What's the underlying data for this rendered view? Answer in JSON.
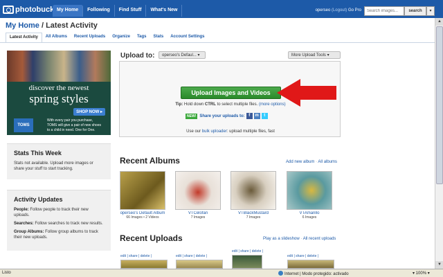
{
  "topbar": {
    "logo": "photobucket",
    "nav": [
      "My Home",
      "Following",
      "Find Stuff",
      "What's New"
    ],
    "user": "operseo",
    "logout": "(Logout)",
    "gopro": "Go Pro",
    "search_placeholder": "Search images...",
    "search_button": "search",
    "search_drop": "▾"
  },
  "page": {
    "title_main": "My Home",
    "title_sep": " / ",
    "title_sub": "Latest Activity",
    "tabs": [
      "Latest Activity",
      "All Albums",
      "Recent Uploads",
      "Organize",
      "Tags",
      "Stats",
      "Account Settings"
    ]
  },
  "ad": {
    "line1": "discover the newest",
    "line2": "spring styles",
    "shop": "SHOP NOW ▸",
    "brand": "TOMS",
    "tagline_1": "With every pair you purchase,",
    "tagline_2": "TOMS will give a pair of new shoes",
    "tagline_3": "to a child in need. One for One."
  },
  "stats": {
    "title": "Stats This Week",
    "text": "Stats not available. Upload more images or share your stuff to start tracking."
  },
  "activity": {
    "title": "Activity Updates",
    "items": [
      {
        "label": "People:",
        "text": " Follow people to track their new uploads."
      },
      {
        "label": "Searches:",
        "text": " Follow searches to track new results."
      },
      {
        "label": "Group Albums:",
        "text": " Follow group albums to track their new uploads."
      }
    ]
  },
  "upload": {
    "label": "Upload to:",
    "album_select": "operseo's Defaul... ▾",
    "more_tools": "More Upload Tools ▾",
    "button": "Upload Images and Videos",
    "tip_prefix": "Tip:",
    "tip_text": " Hold down ",
    "tip_key": "CTRL",
    "tip_text2": " to select multiple files. ",
    "tip_link": "(more options)",
    "new_badge": "NEW!",
    "share_text": "Share your uploads to:",
    "bulk_prefix": "Use our ",
    "bulk_link": "bulk uploader",
    "bulk_suffix": ": upload multiple files, fast"
  },
  "albums": {
    "title": "Recent Albums",
    "add_link": "Add new album",
    "sep": " · ",
    "all_link": "All albums",
    "items": [
      {
        "name": "operseo's Default Album",
        "count": "66 Images • 2 Videos"
      },
      {
        "name": "VTCelofan",
        "count": "7 Images"
      },
      {
        "name": "VTBlackMustard",
        "count": "7 Images"
      },
      {
        "name": "VTAmarillo",
        "count": "6 Images"
      }
    ]
  },
  "uploads": {
    "title": "Recent Uploads",
    "slideshow": "Play as a slideshow",
    "sep": " · ",
    "all_link": "All recent uploads",
    "edit_links": "edit | share | delete |"
  },
  "statusbar": {
    "left": "Listo",
    "mid": "Internet | Modo protegido: activado",
    "zoom": "▾ 100% ▾"
  },
  "colors": {
    "brand_blue": "#1d5aa8",
    "upload_green": "#2a8a2a",
    "arrow_red": "#e01818"
  }
}
